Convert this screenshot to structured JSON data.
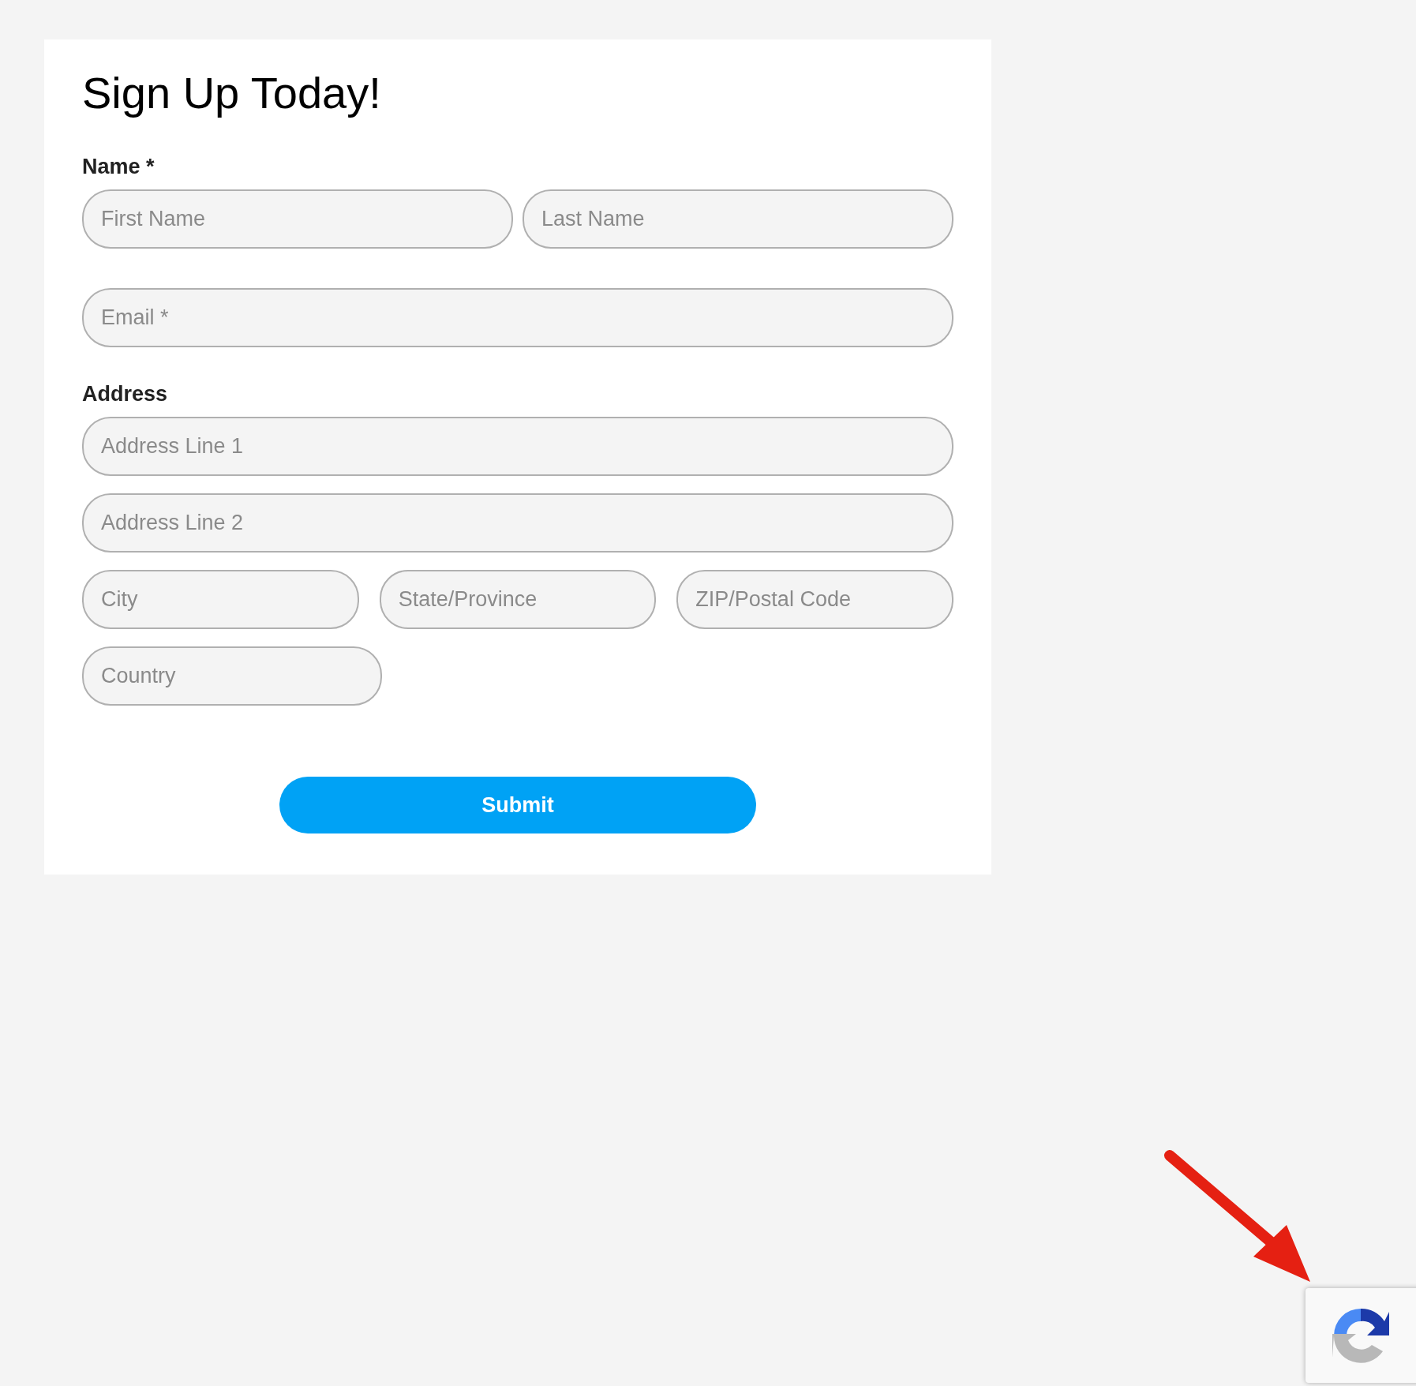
{
  "form": {
    "title": "Sign Up Today!",
    "sections": [
      {
        "label": "Name *",
        "rows": [
          [
            {
              "placeholder": "First Name"
            },
            {
              "placeholder": "Last Name"
            }
          ],
          [
            {
              "placeholder": "Email *"
            }
          ]
        ]
      },
      {
        "label": "Address",
        "rows": [
          [
            {
              "placeholder": "Address Line 1"
            }
          ],
          [
            {
              "placeholder": "Address Line 2"
            }
          ],
          [
            {
              "placeholder": "City"
            },
            {
              "placeholder": "State/Province"
            },
            {
              "placeholder": "ZIP/Postal Code"
            }
          ],
          [
            {
              "placeholder": "Country"
            }
          ]
        ]
      }
    ],
    "submit": "Submit"
  }
}
